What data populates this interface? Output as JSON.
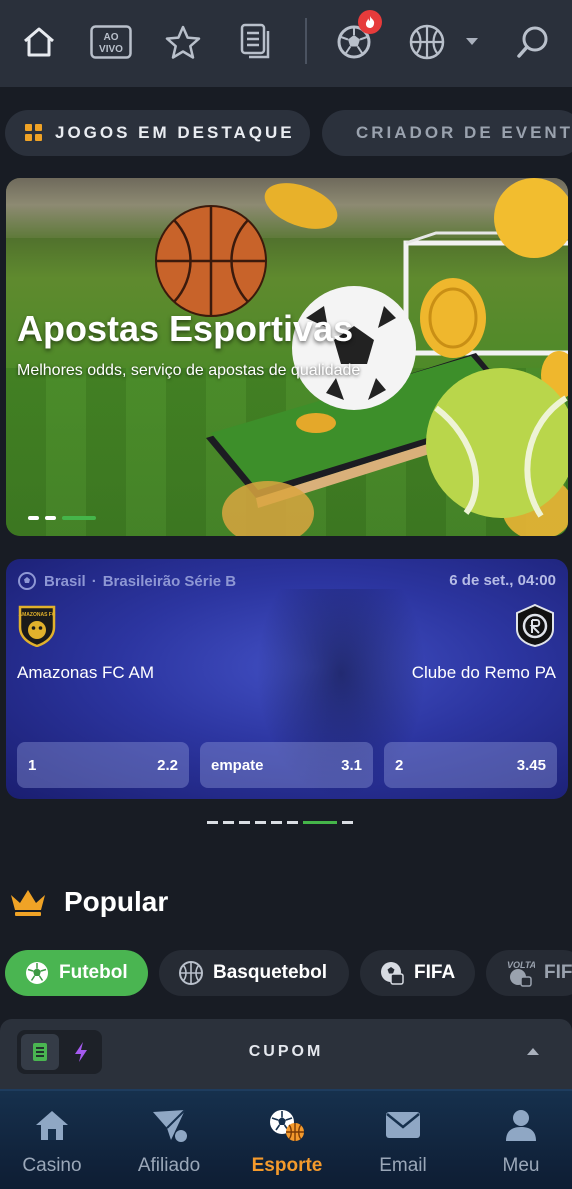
{
  "topnav": {
    "icons": [
      "home-icon",
      "live-icon",
      "star-icon",
      "betslip-icon",
      "football-icon",
      "basketball-icon",
      "chevron-down-icon",
      "search-icon"
    ],
    "live_badge_text": "AO VIVO"
  },
  "categories": {
    "featured": "JOGOS EM DESTAQUE",
    "creator": "CRIADOR DE EVENTOS"
  },
  "banner": {
    "title": "Apostas Esportivas",
    "subtitle": "Melhores odds, serviço de apostas de qualidade",
    "slides": 3,
    "active_slide": 3
  },
  "match": {
    "country": "Brasil",
    "league": "Brasileirão Série B",
    "date": "6 de set., 04:00",
    "home_team": "Amazonas FC AM",
    "away_team": "Clube do Remo PA",
    "home_logo_text": "AMAZONAS FC",
    "odds": [
      {
        "label": "1",
        "value": "2.2"
      },
      {
        "label": "empate",
        "value": "3.1"
      },
      {
        "label": "2",
        "value": "3.45"
      }
    ],
    "cards": 8,
    "active_card": 7
  },
  "popular": {
    "title": "Popular",
    "sports": [
      {
        "label": "Futebol",
        "active": true
      },
      {
        "label": "Basquetebol",
        "active": false
      },
      {
        "label": "FIFA",
        "active": false
      },
      {
        "label": "FIFA",
        "active": false
      }
    ],
    "volta_text": "VOLTA"
  },
  "cupom": {
    "label": "CUPOM"
  },
  "bottomnav": {
    "items": [
      {
        "label": "Casino",
        "icon": "casino-icon"
      },
      {
        "label": "Afiliado",
        "icon": "affiliate-icon"
      },
      {
        "label": "Esporte",
        "icon": "sports-icon"
      },
      {
        "label": "Email",
        "icon": "email-icon"
      },
      {
        "label": "Meu",
        "icon": "user-icon"
      }
    ],
    "active": "Esporte"
  },
  "colors": {
    "accent_green": "#45b54a",
    "accent_orange": "#f49a2c",
    "badge_red": "#e63b3b",
    "background": "#181c24"
  }
}
